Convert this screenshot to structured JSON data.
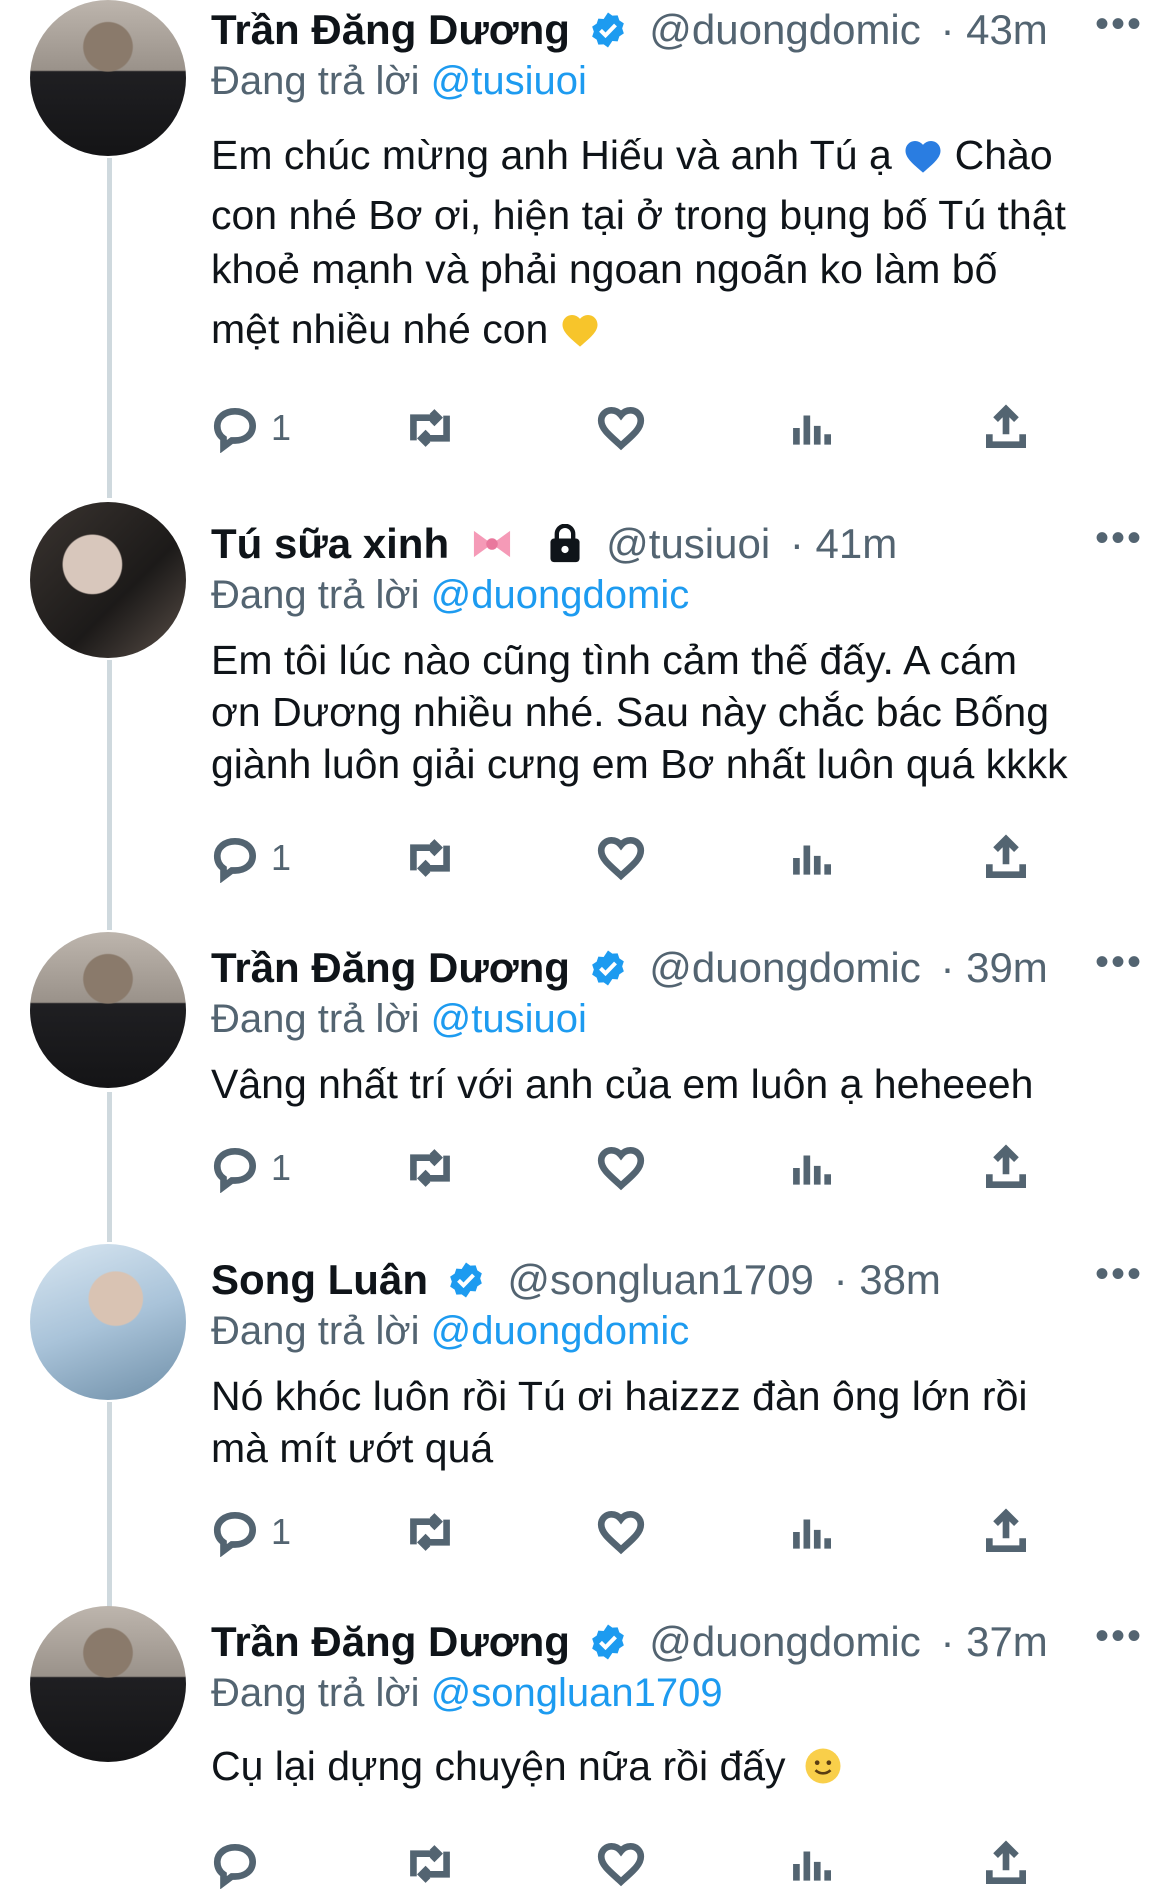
{
  "tweets": [
    {
      "name": "Trần Đăng Dương",
      "verified": true,
      "handle": "@duongdomic",
      "time": "· 43m",
      "reply_label": "Đang trả lời",
      "reply_to": "@tusiuoi",
      "lines": [
        "Em chúc mừng anh Hiếu và anh Tú ạ",
        "Chào",
        "con nhé Bơ ơi, hiện tại ở trong bụng bố Tú thật",
        "khoẻ mạnh và phải ngoan ngoãn ko làm bố",
        "mệt nhiều nhé con"
      ],
      "reply_count": "1"
    },
    {
      "name": "Tú sữa xinh",
      "verified": false,
      "handle": "@tusiuoi",
      "time": "· 41m",
      "reply_label": "Đang trả lời",
      "reply_to": "@duongdomic",
      "lines": [
        "Em tôi lúc nào cũng tình cảm thế đấy. A cám",
        "ơn Dương nhiều nhé. Sau này chắc bác Bống",
        "giành luôn giải cưng em Bơ nhất luôn quá kkkk"
      ],
      "reply_count": "1"
    },
    {
      "name": "Trần Đăng Dương",
      "verified": true,
      "handle": "@duongdomic",
      "time": "· 39m",
      "reply_label": "Đang trả lời",
      "reply_to": "@tusiuoi",
      "lines": [
        "Vâng nhất trí với anh của em luôn ạ heheeeh"
      ],
      "reply_count": "1"
    },
    {
      "name": "Song Luân",
      "verified": true,
      "handle": "@songluan1709",
      "time": "· 38m",
      "reply_label": "Đang trả lời",
      "reply_to": "@duongdomic",
      "lines": [
        "Nó khóc luôn rồi Tú ơi haizzz đàn ông lớn rồi",
        "mà mít ướt quá"
      ],
      "reply_count": "1"
    },
    {
      "name": "Trần Đăng Dương",
      "verified": true,
      "handle": "@duongdomic",
      "time": "· 37m",
      "reply_label": "Đang trả lời",
      "reply_to": "@songluan1709",
      "lines": [
        "Cụ lại dựng chuyện nữa rồi đấy"
      ],
      "reply_count": ""
    }
  ],
  "colors": {
    "link": "#1d9bf0",
    "verified": "#1d9bf0",
    "muted": "#536471",
    "thread_line": "#cfd9de"
  },
  "icons": [
    "reply-icon",
    "retweet-icon",
    "like-icon",
    "analytics-icon",
    "share-icon",
    "more-icon",
    "verified-badge-icon",
    "lock-icon"
  ]
}
